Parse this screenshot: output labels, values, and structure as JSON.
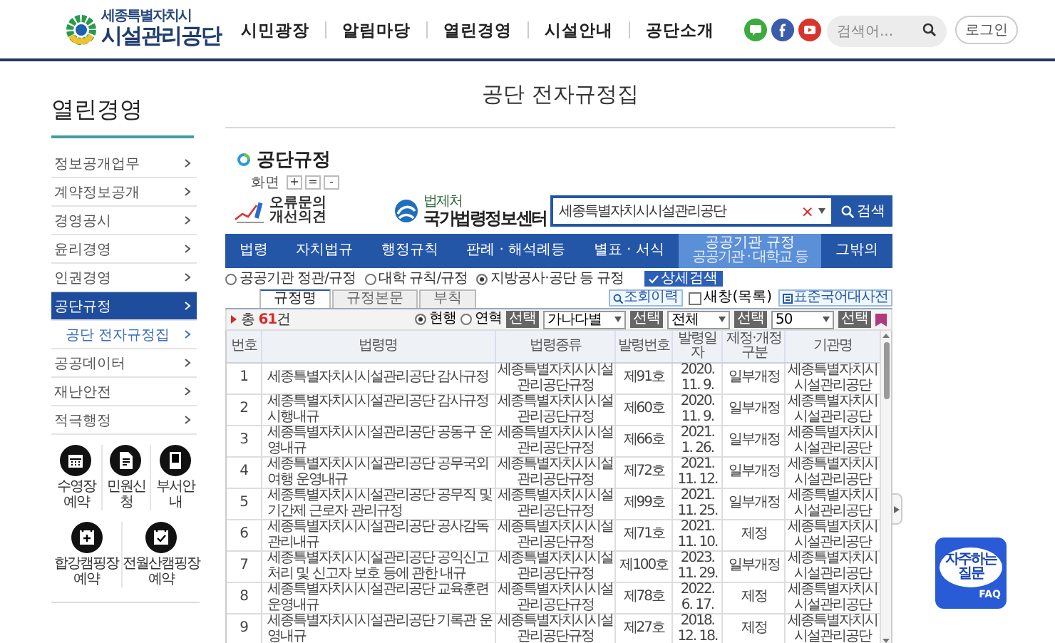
{
  "header": {
    "logo": {
      "subtitle": "세종특별자치시",
      "title": "시설관리공단"
    },
    "nav": [
      "시민광장",
      "알림마당",
      "열린경영",
      "시설안내",
      "공단소개"
    ],
    "search": {
      "placeholder": "검색어..."
    },
    "login": "로그인"
  },
  "sidebar": {
    "title": "열린경영",
    "items": [
      {
        "label": "정보공개업무",
        "selected": false
      },
      {
        "label": "계약정보공개",
        "selected": false
      },
      {
        "label": "경영공시",
        "selected": false
      },
      {
        "label": "윤리경영",
        "selected": false
      },
      {
        "label": "인권경영",
        "selected": false
      },
      {
        "label": "공단규정",
        "selected": true,
        "children": [
          {
            "label": "공단 전자규정집",
            "selected": false
          }
        ]
      },
      {
        "label": "공공데이터",
        "selected": false
      },
      {
        "label": "재난안전",
        "selected": false
      },
      {
        "label": "적극행정",
        "selected": false
      }
    ],
    "quick_links": [
      {
        "label": "수영장예약",
        "kind": "calendar"
      },
      {
        "label": "민원신청",
        "kind": "document"
      },
      {
        "label": "부서안내",
        "kind": "door"
      }
    ],
    "booking_links": [
      {
        "label": "합강캠핑장 예약",
        "kind": "calendar-plus"
      },
      {
        "label": "전월산캠핑장 예약",
        "kind": "calendar-check"
      }
    ]
  },
  "page_title": "공단 전자규정집",
  "section": {
    "title": "공단규정",
    "zoom": {
      "label": "화면",
      "buttons": [
        "+",
        "=",
        "-"
      ]
    }
  },
  "widget": {
    "feedback": "오류문의 개선의견",
    "center_logo": {
      "org": "법제처",
      "name": "국가법령정보센터"
    },
    "search": {
      "value": "세종특별자치시시설관리공단",
      "clear": "×",
      "button": "검색"
    },
    "nav": [
      {
        "label": "법령",
        "selected": false
      },
      {
        "label": "자치법규",
        "selected": false
      },
      {
        "label": "행정규칙",
        "selected": false
      },
      {
        "label": "판례 · 해석례등",
        "selected": false
      },
      {
        "label": "별표 · 서식",
        "selected": false
      },
      {
        "label": "공공기관 규정",
        "sublabel": "공공기관 · 대학교 등",
        "selected": true
      },
      {
        "label": "그밖의",
        "selected": false
      }
    ],
    "scope_options": [
      {
        "label": "공공기관 정관/규정",
        "selected": false
      },
      {
        "label": "대학 규칙/규정",
        "selected": false
      },
      {
        "label": "지방공사·공단 등 규정",
        "selected": true
      }
    ],
    "detail_search": "상세검색",
    "tabs": [
      {
        "label": "규정명",
        "selected": true
      },
      {
        "label": "규정본문",
        "selected": false
      },
      {
        "label": "부칙",
        "selected": false
      }
    ],
    "tools": {
      "history": "조회이력",
      "new_window": {
        "label": "새창(목록)",
        "checked": false
      },
      "dictionary": "표준국어대사전"
    },
    "count": "총 **61**건",
    "status_options": [
      {
        "label": "현행",
        "selected": true
      },
      {
        "label": "연혁",
        "selected": false
      }
    ],
    "status_button": "선택",
    "selects": [
      {
        "value": "가나다별",
        "button": "선택"
      },
      {
        "value": "전체",
        "button": "선택"
      },
      {
        "value": "50",
        "button": "선택"
      }
    ],
    "table": {
      "columns": [
        "번호",
        "법령명",
        "법령종류",
        "발령번호",
        "발령일자",
        "제정·개정 구분",
        "기관명"
      ],
      "rows": [
        [
          "1",
          "세종특별자치시시설관리공단 감사규정",
          "세종특별자치시시설관리공단규정",
          "제91호",
          "2020. 11. 9.",
          "일부개정",
          "세종특별자치시시설관리공단"
        ],
        [
          "2",
          "세종특별자치시시설관리공단 감사규정 시행내규",
          "세종특별자치시시설관리공단규정",
          "제60호",
          "2020. 11. 9.",
          "일부개정",
          "세종특별자치시시설관리공단"
        ],
        [
          "3",
          "세종특별자치시시설관리공단 공동구 운영내규",
          "세종특별자치시시설관리공단규정",
          "제66호",
          "2021. 1. 26.",
          "일부개정",
          "세종특별자치시시설관리공단"
        ],
        [
          "4",
          "세종특별자치시시설관리공단 공무국외여행 운영내규",
          "세종특별자치시시설관리공단규정",
          "제72호",
          "2021. 11. 12.",
          "일부개정",
          "세종특별자치시시설관리공단"
        ],
        [
          "5",
          "세종특별자치시시설관리공단 공무직 및 기간제 근로자 관리규정",
          "세종특별자치시시설관리공단규정",
          "제99호",
          "2021. 11. 25.",
          "일부개정",
          "세종특별자치시시설관리공단"
        ],
        [
          "6",
          "세종특별자치시시설관리공단 공사감독관리내규",
          "세종특별자치시시설관리공단규정",
          "제71호",
          "2021. 11. 10.",
          "제정",
          "세종특별자치시시설관리공단"
        ],
        [
          "7",
          "세종특별자치시시설관리공단 공익신고 처리 및 신고자 보호 등에 관한 내규",
          "세종특별자치시시설관리공단규정",
          "제100호",
          "2023. 11. 29.",
          "일부개정",
          "세종특별자치시시설관리공단"
        ],
        [
          "8",
          "세종특별자치시시설관리공단 교육훈련 운영내규",
          "세종특별자치시시설관리공단규정",
          "제78호",
          "2022. 6. 17.",
          "제정",
          "세종특별자치시시설관리공단"
        ],
        [
          "9",
          "세종특별자치시시설관리공단 기록관 운영내규",
          "세종특별자치시시설관리공단규정",
          "제27호",
          "2018. 12. 18.",
          "제정",
          "세종특별자치시시설관리공단"
        ]
      ]
    }
  },
  "faq": {
    "label": "자주하는 질문",
    "badge": "FAQ"
  }
}
